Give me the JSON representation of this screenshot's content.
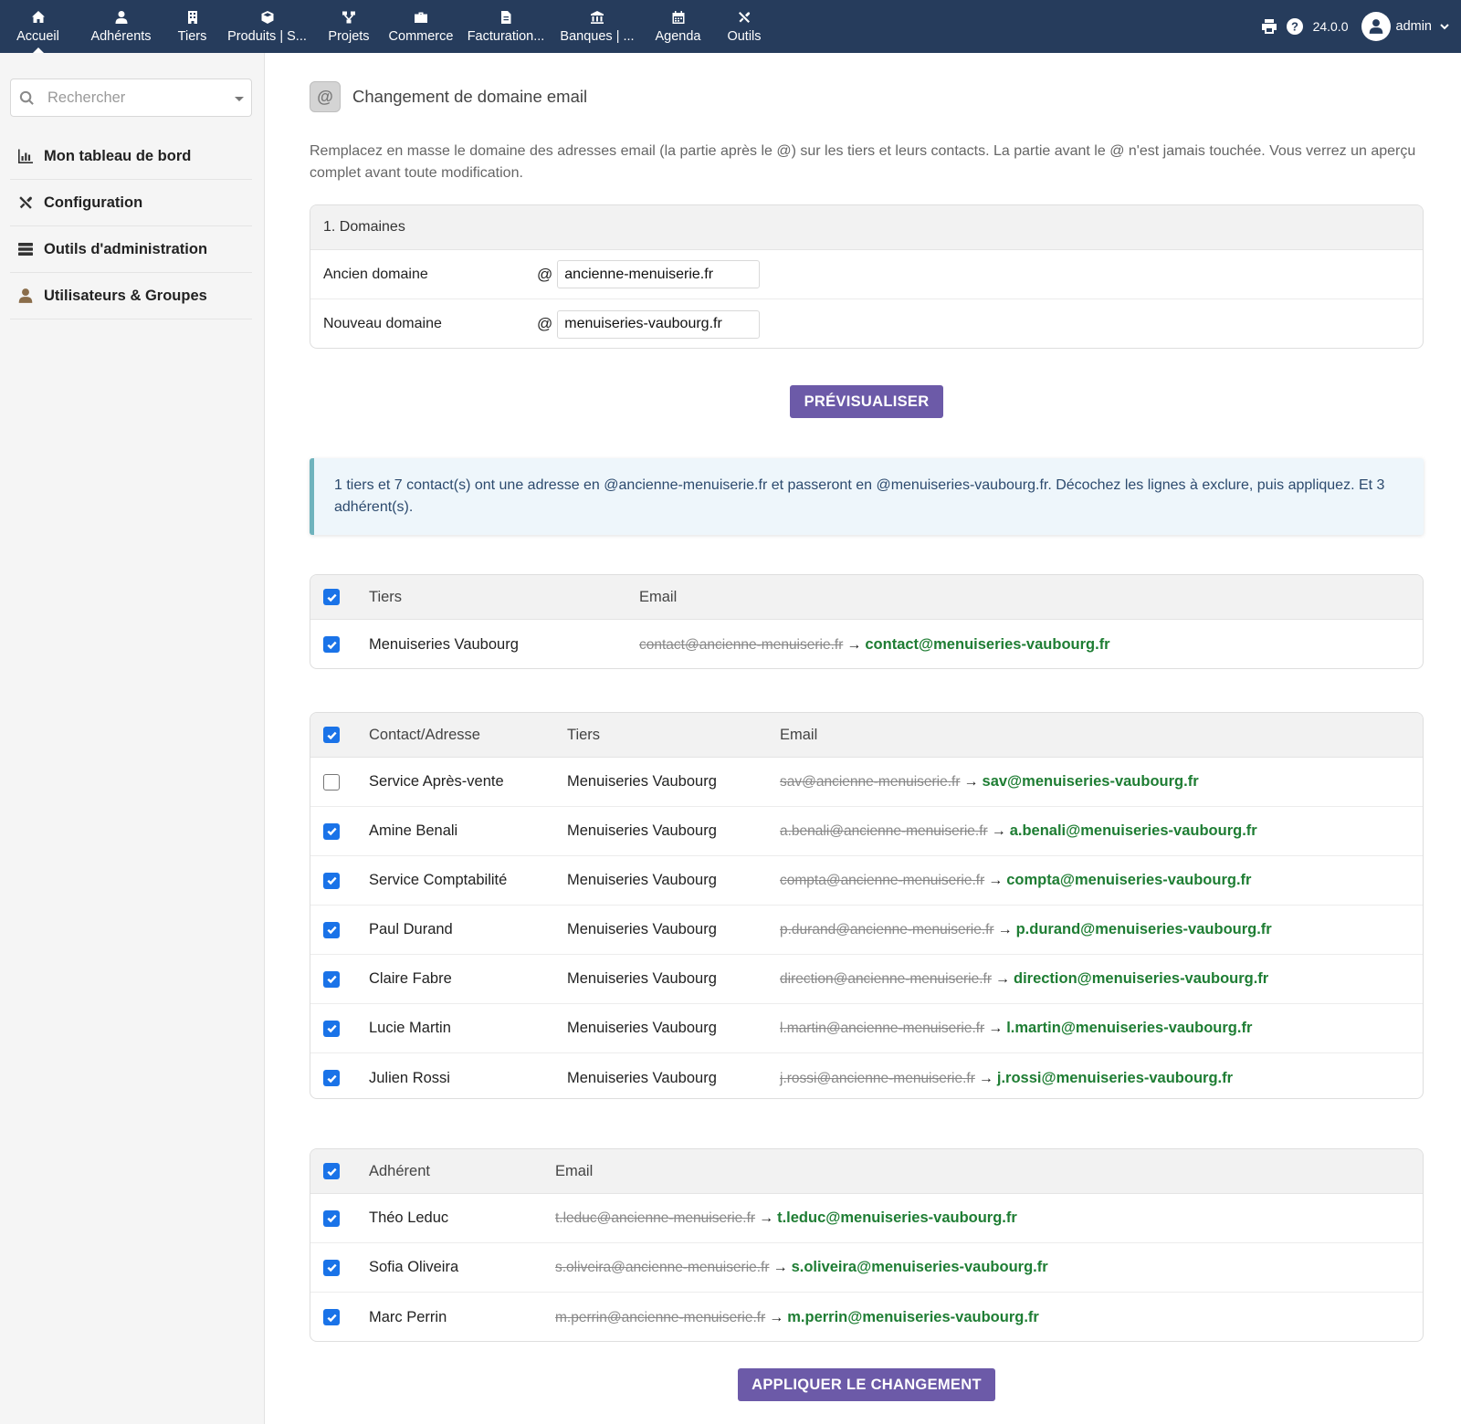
{
  "topnav": {
    "items": [
      {
        "label": "Accueil",
        "icon": "home-icon",
        "active": true
      },
      {
        "label": "Adhérents",
        "icon": "user-icon"
      },
      {
        "label": "Tiers",
        "icon": "building-icon"
      },
      {
        "label": "Produits | S...",
        "icon": "cube-icon"
      },
      {
        "label": "Projets",
        "icon": "sitemap-icon"
      },
      {
        "label": "Commerce",
        "icon": "briefcase-icon"
      },
      {
        "label": "Facturation...",
        "icon": "file-invoice-icon"
      },
      {
        "label": "Banques | ...",
        "icon": "bank-icon"
      },
      {
        "label": "Agenda",
        "icon": "calendar-icon"
      },
      {
        "label": "Outils",
        "icon": "tools-icon"
      }
    ],
    "version": "24.0.0",
    "user": "admin"
  },
  "sidebar": {
    "search_placeholder": "Rechercher",
    "items": [
      {
        "label": "Mon tableau de bord",
        "icon": "chart-bar-icon"
      },
      {
        "label": "Configuration",
        "icon": "tools-icon"
      },
      {
        "label": "Outils d'administration",
        "icon": "server-icon"
      },
      {
        "label": "Utilisateurs & Groupes",
        "icon": "user-icon"
      }
    ]
  },
  "page": {
    "icon_glyph": "@",
    "title": "Changement de domaine email",
    "intro": "Remplacez en masse le domaine des adresses email (la partie après le @) sur les tiers et leurs contacts. La partie avant le @ n'est jamais touchée. Vous verrez un aperçu complet avant toute modification."
  },
  "domains": {
    "header": "1. Domaines",
    "at": "@",
    "old_label": "Ancien domaine",
    "old_value": "ancienne-menuiserie.fr",
    "new_label": "Nouveau domaine",
    "new_value": "menuiseries-vaubourg.fr"
  },
  "buttons": {
    "preview": "PRÉVISUALISER",
    "apply": "APPLIQUER LE CHANGEMENT"
  },
  "info": "1 tiers et 7 contact(s) ont une adresse en @ancienne-menuiserie.fr et passeront en @menuiseries-vaubourg.fr. Décochez les lignes à exclure, puis appliquez. Et 3 adhérent(s).",
  "arrow": "→",
  "tiers_table": {
    "headers": {
      "name": "Tiers",
      "email": "Email"
    },
    "header_checked": true,
    "rows": [
      {
        "checked": true,
        "name": "Menuiseries Vaubourg",
        "old": "contact@ancienne-menuiserie.fr",
        "new": "contact@menuiseries-vaubourg.fr"
      }
    ]
  },
  "contacts_table": {
    "headers": {
      "contact": "Contact/Adresse",
      "tiers": "Tiers",
      "email": "Email"
    },
    "header_checked": true,
    "rows": [
      {
        "checked": false,
        "contact": "Service Après-vente",
        "tiers": "Menuiseries Vaubourg",
        "old": "sav@ancienne-menuiserie.fr",
        "new": "sav@menuiseries-vaubourg.fr"
      },
      {
        "checked": true,
        "contact": "Amine Benali",
        "tiers": "Menuiseries Vaubourg",
        "old": "a.benali@ancienne-menuiserie.fr",
        "new": "a.benali@menuiseries-vaubourg.fr"
      },
      {
        "checked": true,
        "contact": "Service Comptabilité",
        "tiers": "Menuiseries Vaubourg",
        "old": "compta@ancienne-menuiserie.fr",
        "new": "compta@menuiseries-vaubourg.fr"
      },
      {
        "checked": true,
        "contact": "Paul Durand",
        "tiers": "Menuiseries Vaubourg",
        "old": "p.durand@ancienne-menuiserie.fr",
        "new": "p.durand@menuiseries-vaubourg.fr"
      },
      {
        "checked": true,
        "contact": "Claire Fabre",
        "tiers": "Menuiseries Vaubourg",
        "old": "direction@ancienne-menuiserie.fr",
        "new": "direction@menuiseries-vaubourg.fr"
      },
      {
        "checked": true,
        "contact": "Lucie Martin",
        "tiers": "Menuiseries Vaubourg",
        "old": "l.martin@ancienne-menuiserie.fr",
        "new": "l.martin@menuiseries-vaubourg.fr"
      },
      {
        "checked": true,
        "contact": "Julien Rossi",
        "tiers": "Menuiseries Vaubourg",
        "old": "j.rossi@ancienne-menuiserie.fr",
        "new": "j.rossi@menuiseries-vaubourg.fr"
      }
    ]
  },
  "members_table": {
    "headers": {
      "name": "Adhérent",
      "email": "Email"
    },
    "header_checked": true,
    "rows": [
      {
        "checked": true,
        "name": "Théo Leduc",
        "old": "t.leduc@ancienne-menuiserie.fr",
        "new": "t.leduc@menuiseries-vaubourg.fr"
      },
      {
        "checked": true,
        "name": "Sofia Oliveira",
        "old": "s.oliveira@ancienne-menuiserie.fr",
        "new": "s.oliveira@menuiseries-vaubourg.fr"
      },
      {
        "checked": true,
        "name": "Marc Perrin",
        "old": "m.perrin@ancienne-menuiserie.fr",
        "new": "m.perrin@menuiseries-vaubourg.fr"
      }
    ]
  },
  "colors": {
    "topbar": "#263c5c",
    "button": "#6c5aa8",
    "new_email": "#1e7d33",
    "checkbox": "#1a73e8",
    "info_border": "#6fb3bd"
  }
}
